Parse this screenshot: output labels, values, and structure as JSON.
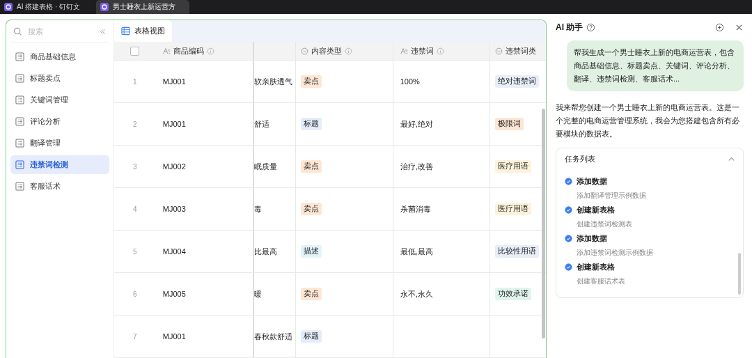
{
  "browser_tabs": [
    {
      "title": "AI 搭建表格 · 钉钉文",
      "selected": false
    },
    {
      "title": "男士睡衣上新运营方",
      "selected": true
    }
  ],
  "sidebar": {
    "search": {
      "placeholder": "搜索"
    },
    "items": [
      {
        "label": "商品基础信息",
        "selected": false
      },
      {
        "label": "标题卖点",
        "selected": false
      },
      {
        "label": "关键词管理",
        "selected": false
      },
      {
        "label": "评论分析",
        "selected": false
      },
      {
        "label": "翻译管理",
        "selected": false
      },
      {
        "label": "违禁词检测",
        "selected": true
      },
      {
        "label": "客服话术",
        "selected": false
      }
    ]
  },
  "view_tab": {
    "label": "表格视图"
  },
  "table": {
    "select_all_checked": false,
    "columns": [
      {
        "label": "商品编码",
        "kind": "text"
      },
      {
        "kind": "blank"
      },
      {
        "label": "内容类型",
        "kind": "select"
      },
      {
        "label": "违禁词",
        "kind": "text"
      },
      {
        "label": "违禁词类",
        "kind": "select"
      }
    ],
    "rows": [
      {
        "index": "1",
        "code": "MJ001",
        "column_3": "软亲肤透气",
        "type": {
          "text": "卖点",
          "color": "#fde6d4"
        },
        "word": "100%",
        "category": {
          "text": "绝对违禁词",
          "color": "#e8eef8"
        }
      },
      {
        "index": "2",
        "code": "MJ001",
        "column_3": "舒适",
        "type": {
          "text": "标题",
          "color": "#e3edfb"
        },
        "word": "最好,绝对",
        "category": {
          "text": "极限词",
          "color": "#fde6d4"
        }
      },
      {
        "index": "3",
        "code": "MJ002",
        "column_3": "眠质量",
        "type": {
          "text": "卖点",
          "color": "#fde6d4"
        },
        "word": "治疗,改善",
        "category": {
          "text": "医疗用语",
          "color": "#fdf3dc"
        }
      },
      {
        "index": "4",
        "code": "MJ003",
        "column_3": "毒",
        "type": {
          "text": "卖点",
          "color": "#fde6d4"
        },
        "word": "杀菌消毒",
        "category": {
          "text": "医疗用语",
          "color": "#fdf3dc"
        }
      },
      {
        "index": "5",
        "code": "MJ004",
        "column_3": "比最高",
        "type": {
          "text": "描述",
          "color": "#e2f3fb"
        },
        "word": "最低,最高",
        "category": {
          "text": "比较性用语",
          "color": "#e8eef8"
        }
      },
      {
        "index": "6",
        "code": "MJ005",
        "column_3": "暖",
        "type": {
          "text": "卖点",
          "color": "#fde6d4"
        },
        "word": "永不,永久",
        "category": {
          "text": "功效承诺",
          "color": "#dff4ec"
        }
      },
      {
        "index": "7",
        "code": "MJ001",
        "column_3": "春秋款舒适",
        "type": {
          "text": "标题",
          "color": "#e3edfb"
        },
        "word": "",
        "category": null
      }
    ]
  },
  "assistant": {
    "title": "AI 助手",
    "user_message": "帮我生成一个男士睡衣上新的电商运营表，包含商品基础信息、标题卖点、关键词、评论分析、翻译、违禁词检测、客服话术...",
    "reply": "我来帮您创建一个男士睡衣上新的电商运营表。这是一个完整的电商运营管理系统，我会为您搭建包含所有必要模块的数据表。",
    "task_list": {
      "title": "任务列表",
      "expanded": true,
      "tasks": [
        {
          "title": "添加数据",
          "detail": "添加翻译管理示例数据",
          "checked": true
        },
        {
          "title": "创建新表格",
          "detail": "创建违禁词检测表",
          "checked": true
        },
        {
          "title": "添加数据",
          "detail": "添加违禁词检测示例数据",
          "checked": true
        },
        {
          "title": "创建新表格",
          "detail": "创建客服话术表",
          "checked": true
        }
      ]
    }
  }
}
